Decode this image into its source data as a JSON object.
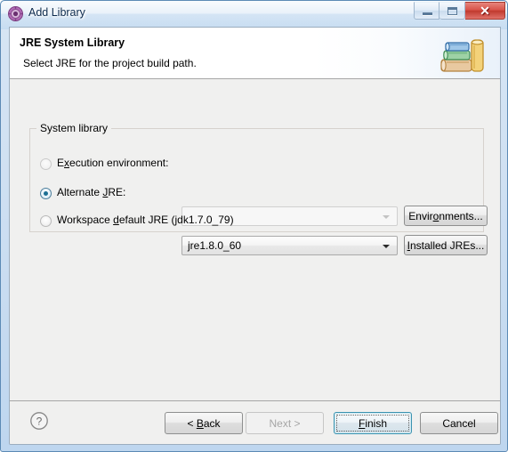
{
  "window": {
    "title": "Add Library",
    "icon": "eclipse-library-icon",
    "controls": {
      "minimize": "Minimize",
      "maximize": "Maximize",
      "close": "✕"
    }
  },
  "banner": {
    "title": "JRE System Library",
    "subtitle": "Select JRE for the project build path.",
    "icon": "books-stack-icon"
  },
  "group": {
    "legend": "System library",
    "options": [
      {
        "id": "execution-environment",
        "label_pre": "E",
        "label_mnemonic": "x",
        "label_post": "ecution environment:",
        "selected": false,
        "enabled": false
      },
      {
        "id": "alternate-jre",
        "label_pre": "Alternate ",
        "label_mnemonic": "J",
        "label_post": "RE:",
        "selected": true,
        "enabled": true
      },
      {
        "id": "workspace-default-jre",
        "label_pre": "Workspace ",
        "label_mnemonic": "d",
        "label_post": "efault JRE (jdk1.7.0_79)",
        "selected": false,
        "enabled": true
      }
    ],
    "execution_environment_combo": {
      "value": "",
      "enabled": false
    },
    "alternate_jre_combo": {
      "value": "jre1.8.0_60",
      "enabled": true
    },
    "environments_button": {
      "pre": "Envir",
      "mnemonic": "o",
      "post": "nments..."
    },
    "installed_jres_button": {
      "pre": "",
      "mnemonic": "I",
      "post": "nstalled JREs..."
    }
  },
  "footer": {
    "help_icon": "help-question-icon",
    "buttons": [
      {
        "id": "back",
        "pre": "< ",
        "mnemonic": "B",
        "post": "ack",
        "enabled": true,
        "default": false
      },
      {
        "id": "next",
        "pre": "",
        "mnemonic": "N",
        "post": "ext >",
        "enabled": false,
        "default": false
      },
      {
        "id": "finish",
        "pre": "",
        "mnemonic": "F",
        "post": "inish",
        "enabled": true,
        "default": true
      },
      {
        "id": "cancel",
        "pre": "Cancel",
        "mnemonic": "",
        "post": "",
        "enabled": true,
        "default": false
      }
    ]
  },
  "colors": {
    "accent": "#1d6f93",
    "default_button_border": "#3c93b0",
    "close_button": "#c03a2e",
    "dialog_background": "#f0f0ef",
    "banner_background": "#ffffff"
  }
}
